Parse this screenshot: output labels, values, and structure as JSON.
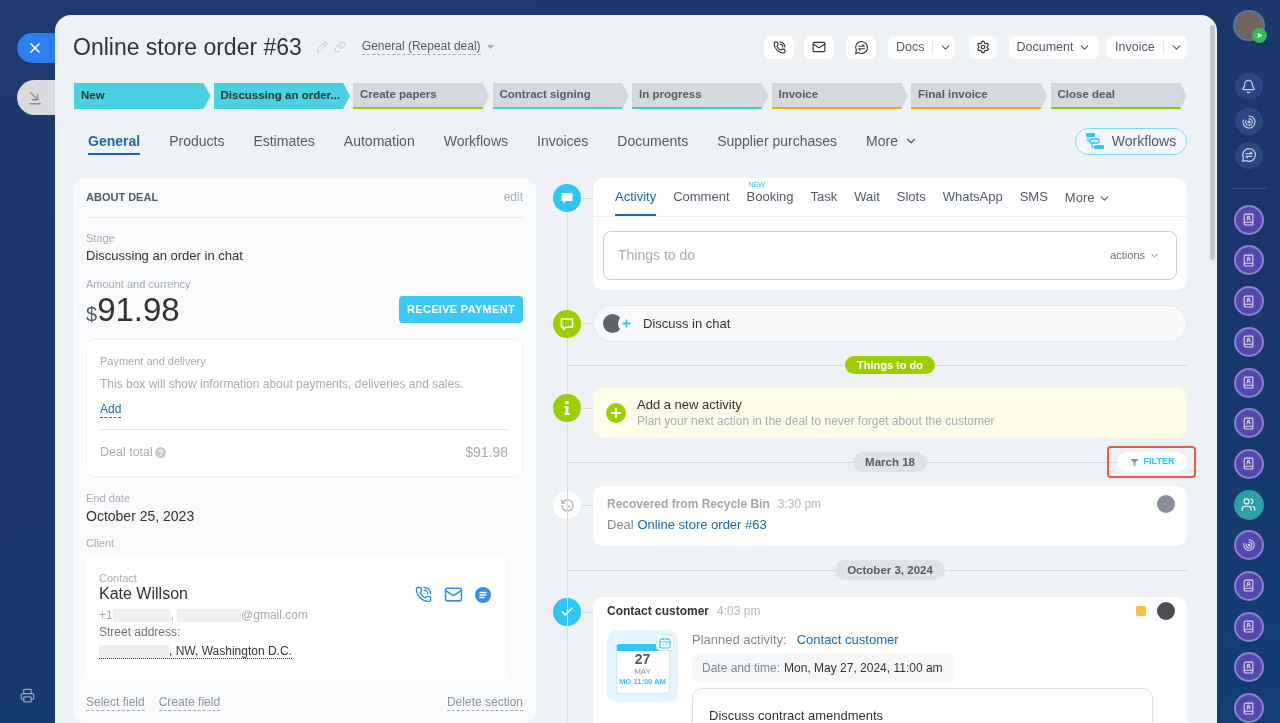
{
  "header": {
    "title": "Online store order #63",
    "category": "General (Repeat deal)",
    "docs": "Docs",
    "document": "Document",
    "invoice": "Invoice"
  },
  "stages": [
    {
      "label": "New",
      "color": "#47d1e2",
      "reached": true
    },
    {
      "label": "Discussing an order...",
      "color": "#47d1e2",
      "reached": true
    },
    {
      "label": "Create papers",
      "color": "#9dcf00",
      "reached": false
    },
    {
      "label": "Contract signing",
      "color": "#47d1e2",
      "reached": false
    },
    {
      "label": "In progress",
      "color": "#2fd8c4",
      "reached": false
    },
    {
      "label": "Invoice",
      "color": "#ffa900",
      "reached": false
    },
    {
      "label": "Final invoice",
      "color": "#ffa900",
      "reached": false
    },
    {
      "label": "Close deal",
      "color": "#7bd500",
      "reached": false
    }
  ],
  "tabs": [
    {
      "label": "General",
      "selected": true
    },
    {
      "label": "Products",
      "selected": false
    },
    {
      "label": "Estimates",
      "selected": false
    },
    {
      "label": "Automation",
      "selected": false
    },
    {
      "label": "Workflows",
      "selected": false
    },
    {
      "label": "Invoices",
      "selected": false
    },
    {
      "label": "Documents",
      "selected": false
    },
    {
      "label": "Supplier purchases",
      "selected": false
    }
  ],
  "tabs_more": "More",
  "workflows_button": "Workflows",
  "about_deal": {
    "heading": "ABOUT DEAL",
    "edit": "edit",
    "stage_label": "Stage",
    "stage_value": "Discussing an order in chat",
    "amount_label": "Amount and currency",
    "currency": "$",
    "amount": "91.98",
    "receive_payment": "RECEIVE PAYMENT",
    "payment_box": {
      "title": "Payment and delivery",
      "text": "This box will show information about payments, deliveries and sales.",
      "add": "Add",
      "total_label": "Deal total",
      "total_value": "$91.98"
    },
    "end_date_label": "End date",
    "end_date": "October 25, 2023",
    "client_label": "Client",
    "contact": {
      "label": "Contact",
      "name": "Kate Willson",
      "phone_prefix": "+1",
      "separator": ",",
      "email_suffix": "@gmail.com",
      "address_label": "Street address:",
      "address_suffix": ", NW, Washington D.C."
    },
    "footer_links": [
      "Select field",
      "Create field"
    ],
    "delete_section": "Delete section"
  },
  "activity_editor": {
    "tabs": [
      {
        "label": "Activity",
        "selected": true
      },
      {
        "label": "Comment",
        "selected": false
      },
      {
        "label": "Booking",
        "selected": false,
        "badge": "NEW"
      },
      {
        "label": "Task",
        "selected": false
      },
      {
        "label": "Wait",
        "selected": false
      },
      {
        "label": "Slots",
        "selected": false
      },
      {
        "label": "WhatsApp",
        "selected": false
      },
      {
        "label": "SMS",
        "selected": false
      }
    ],
    "more": "More",
    "input": {
      "placeholder": "Things to do"
    },
    "actions": "actions"
  },
  "timeline": {
    "chat": "Discuss in chat",
    "pending_badge": "Things to do",
    "new_activity": {
      "title": "Add a new activity",
      "text": "Plan your next action in the deal to never forget about the customer"
    },
    "groups": [
      {
        "date": "March 18",
        "filter": "FILTER",
        "entries": [
          {
            "kind": "restored",
            "title": "Recovered from Recycle Bin",
            "time": "3:30 pm",
            "prefix": "Deal",
            "link": "Online store order #63"
          }
        ]
      },
      {
        "date": "October 3, 2024",
        "entries": [
          {
            "kind": "activity",
            "title": "Contact customer",
            "time": "4:03 pm",
            "calendar": {
              "day": "27",
              "month": "MAY",
              "time": "MO 11:00 AM"
            },
            "planned_label": "Planned activity:",
            "planned_link": "Contact customer",
            "datetime_label": "Date and time:",
            "datetime": "Mon, May 27, 2024, 11:00 am",
            "description": "Discuss contract amendments"
          }
        ]
      }
    ]
  }
}
